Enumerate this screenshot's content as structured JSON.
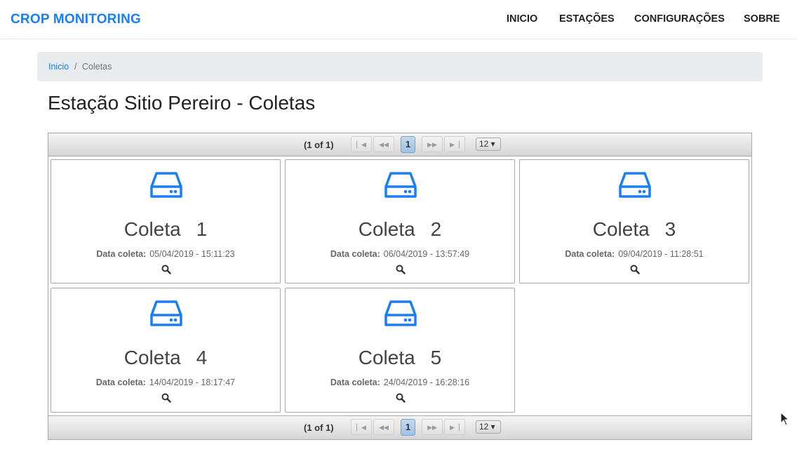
{
  "navbar": {
    "brand": "CROP MONITORING",
    "items": [
      "INICIO",
      "ESTAÇÕES",
      "CONFIGURAÇÕES",
      "SOBRE"
    ]
  },
  "breadcrumb": {
    "home": "Inicio",
    "separator": "/",
    "current": "Coletas"
  },
  "page": {
    "title": "Estação Sitio Pereiro - Coletas"
  },
  "paginator": {
    "report": "(1 of 1)",
    "current_page": "1",
    "rows_per_page": "12 ▾"
  },
  "cards": [
    {
      "label": "Coleta",
      "number": "1",
      "date_label": "Data coleta:",
      "date": "05/04/2019 - 15:11:23"
    },
    {
      "label": "Coleta",
      "number": "2",
      "date_label": "Data coleta:",
      "date": "06/04/2019 - 13:57:49"
    },
    {
      "label": "Coleta",
      "number": "3",
      "date_label": "Data coleta:",
      "date": "09/04/2019 - 11:28:51"
    },
    {
      "label": "Coleta",
      "number": "4",
      "date_label": "Data coleta:",
      "date": "14/04/2019 - 18:17:47"
    },
    {
      "label": "Coleta",
      "number": "5",
      "date_label": "Data coleta:",
      "date": "24/04/2019 - 16:28:16"
    }
  ],
  "colors": {
    "accent": "#1a7ff0",
    "page_highlight": "#a6c9e8"
  },
  "icons": {
    "card_icon": "hard-drive-icon",
    "view_icon": "search-icon"
  }
}
